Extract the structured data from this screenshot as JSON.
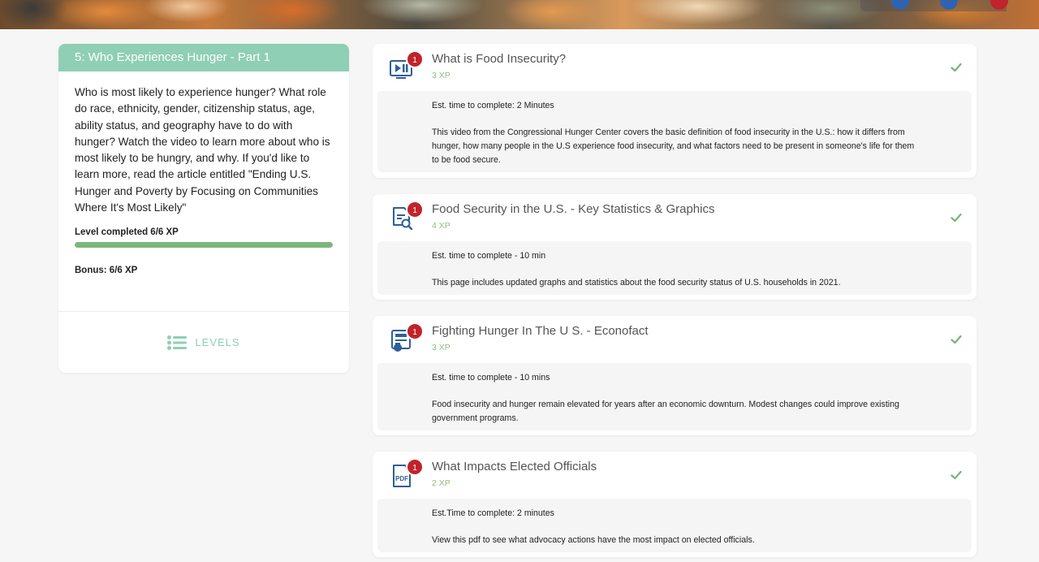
{
  "banner": {
    "dots": [
      {
        "color": "#2f63b0"
      },
      {
        "color": "#2f63b0"
      },
      {
        "color": "#c0232b"
      }
    ]
  },
  "level": {
    "title": "5: Who Experiences Hunger - Part 1",
    "description": "Who is most likely to experience hunger? What role do race, ethnicity, gender, citizenship status, age, ability status, and geography have to do with hunger? Watch the video to learn more about who is most likely to be hungry, and why. If you'd like to learn more, read the article entitled \"Ending U.S. Hunger and Poverty by Focusing on Communities Where It's Most Likely\"",
    "completed_label": "Level completed 6/6 XP",
    "progress_fraction": 1.0,
    "bonus_label": "Bonus: 6/6 XP",
    "levels_button": "LEVELS"
  },
  "colors": {
    "accent": "#8fcfb6",
    "progress": "#7bb77b",
    "badge": "#c0232b",
    "xp": "#8cc07c",
    "icon": "#2f5f98"
  },
  "activities": [
    {
      "icon": "video-icon",
      "badge": "1",
      "title": "What is Food Insecurity?",
      "xp": "3 XP",
      "est": "Est. time to complete: 2 Minutes",
      "description": "This video from the Congressional Hunger Center covers the basic definition of food insecurity in the U.S.: how it differs from hunger, how many people in the U.S experience food insecurity, and what factors need to be present in someone's life for them to be food secure.",
      "completed": true
    },
    {
      "icon": "document-search-icon",
      "badge": "1",
      "title": "Food Security in the U.S. - Key Statistics & Graphics",
      "xp": "4 XP",
      "est": "Est. time to complete - 10 min",
      "description": "This page includes updated graphs and statistics about the food security status of U.S. households in 2021.",
      "completed": true
    },
    {
      "icon": "article-icon",
      "badge": "1",
      "title": "Fighting Hunger In The U S. - Econofact",
      "xp": "3 XP",
      "est": "Est. time to complete - 10 mins",
      "description": "Food insecurity and hunger remain elevated for years after an economic downturn. Modest changes could improve existing government programs.",
      "completed": true
    },
    {
      "icon": "pdf-icon",
      "badge": "1",
      "title": "What Impacts Elected Officials",
      "xp": "2 XP",
      "est": "Est.Time to complete: 2 minutes",
      "description": "View this pdf to see what advocacy actions have the most impact on elected officials.",
      "completed": true
    }
  ]
}
